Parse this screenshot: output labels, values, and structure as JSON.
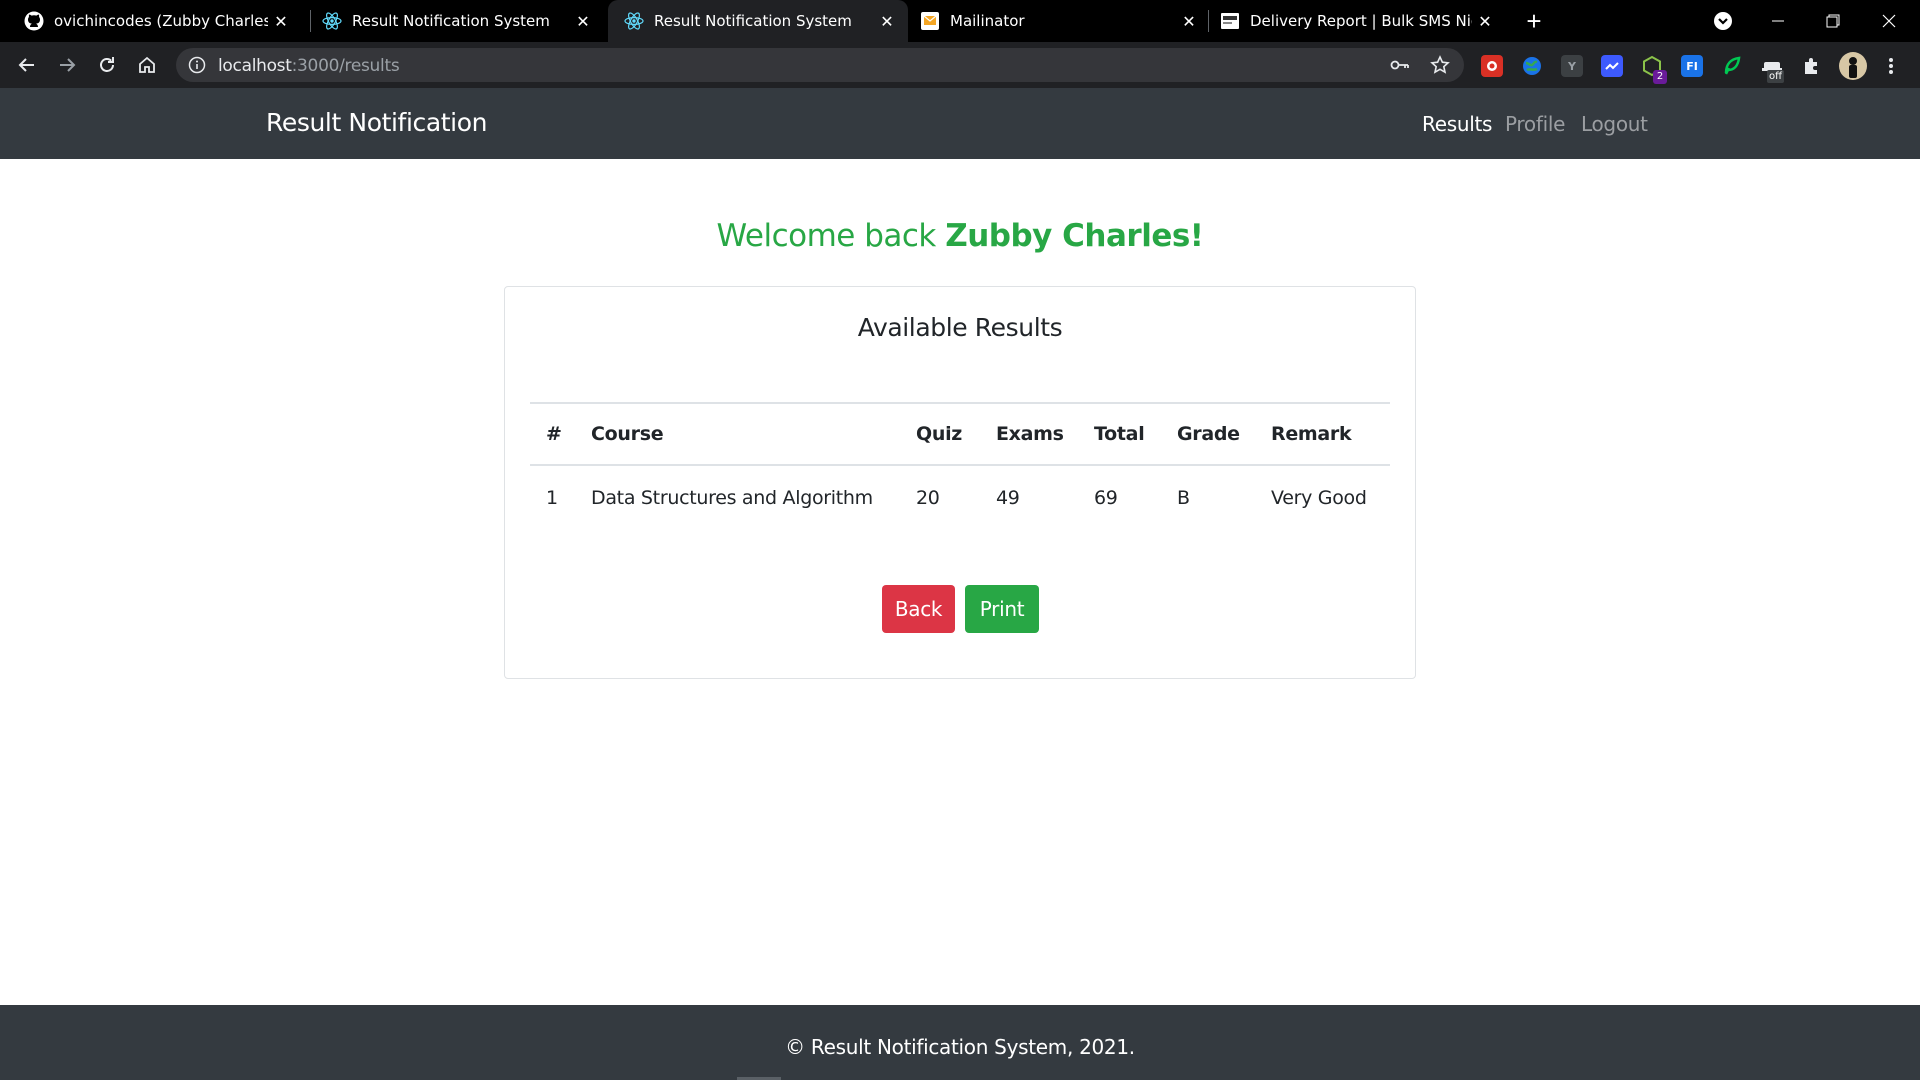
{
  "browser": {
    "tabs": [
      {
        "title": "ovichincodes (Zubby Charles)",
        "icon": "github-icon",
        "active": false
      },
      {
        "title": "Result Notification System",
        "icon": "react-icon",
        "active": false
      },
      {
        "title": "Result Notification System",
        "icon": "react-icon",
        "active": true
      },
      {
        "title": "Mailinator",
        "icon": "mailinator-icon",
        "active": false
      },
      {
        "title": "Delivery Report | Bulk SMS Nigeria",
        "icon": "sms-icon",
        "active": false
      }
    ],
    "close_glyph": "✕",
    "new_tab_glyph": "+",
    "url_host": "localhost",
    "url_path": ":3000/results",
    "extension_badges": {
      "badge_count": "2",
      "badge_off": "off"
    }
  },
  "app": {
    "brand": "Result Notification",
    "nav": {
      "results": "Results",
      "profile": "Profile",
      "logout": "Logout"
    },
    "welcome_prefix": "Welcome back ",
    "welcome_name": "Zubby Charles!",
    "card_title": "Available Results",
    "table": {
      "headers": [
        "#",
        "Course",
        "Quiz",
        "Exams",
        "Total",
        "Grade",
        "Remark"
      ],
      "rows": [
        [
          "1",
          "Data Structures and Algorithm",
          "20",
          "49",
          "69",
          "B",
          "Very Good"
        ]
      ]
    },
    "buttons": {
      "back": "Back",
      "print": "Print"
    },
    "footer": "© Result Notification System, 2021."
  },
  "colors": {
    "navbar": "#343a40",
    "success": "#28a745",
    "danger": "#dc3545"
  }
}
